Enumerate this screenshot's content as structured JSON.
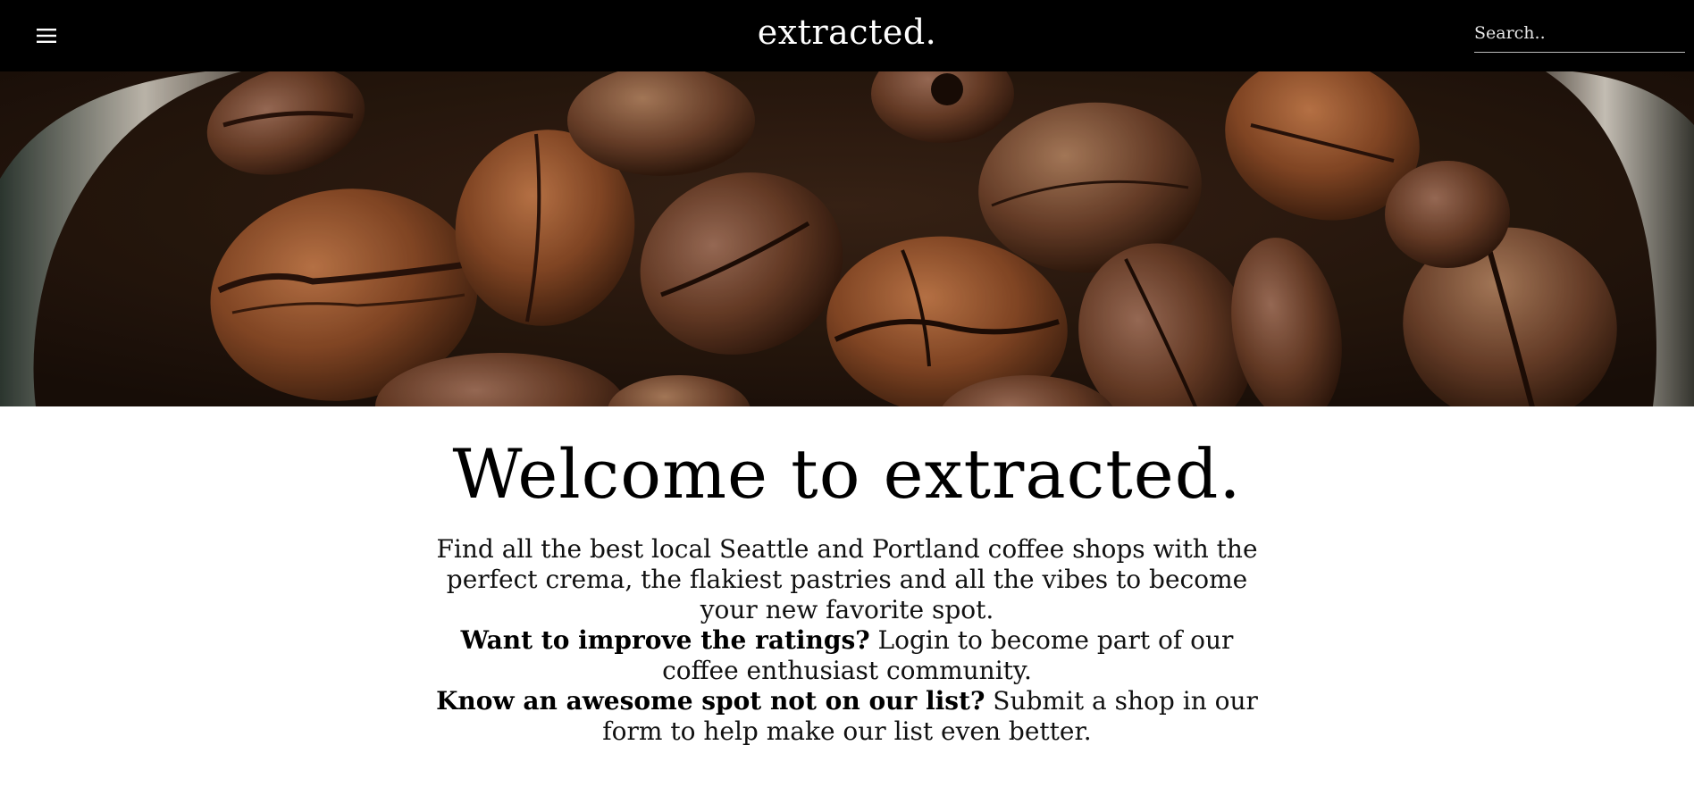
{
  "header": {
    "menu_icon": "hamburger-menu-icon",
    "brand": "extracted.",
    "search_placeholder": "Search.."
  },
  "hero": {
    "image": "coffee-beans-photo"
  },
  "main": {
    "title": "Welcome to extracted.",
    "intro": "Find all the best local Seattle and Portland coffee shops with the perfect crema, the flakiest pastries and all the vibes to become your new favorite spot.",
    "ratings_prompt": "Want to improve the ratings?",
    "ratings_text": " Login to become part of our coffee enthusiast community.",
    "submit_prompt": "Know an awesome spot not on our list?",
    "submit_text": " Submit a shop in our form to help make our list even better."
  },
  "colors": {
    "header_bg": "#000000",
    "header_text": "#ffffff",
    "body_bg": "#ffffff",
    "text": "#000000"
  }
}
